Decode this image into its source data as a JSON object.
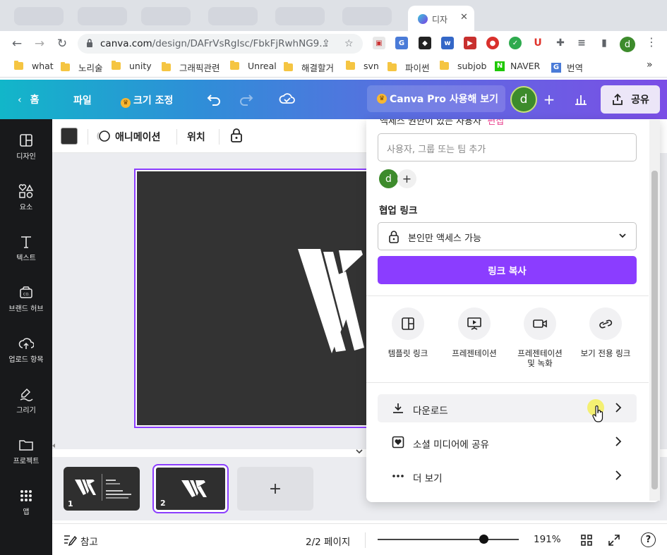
{
  "browser": {
    "active_tab_title": "디자",
    "url_host": "canva.com",
    "url_path": "/design/DAFrVsRgIsc/FbkFjRwhNG9...",
    "profile_initial": "d",
    "bookmarks": [
      "what",
      "노리술",
      "unity",
      "그래픽관련",
      "Unreal",
      "해결할거",
      "svn",
      "파이썬",
      "subjob",
      "NAVER",
      "번역"
    ],
    "more": "»"
  },
  "header": {
    "home": "홈",
    "file": "파일",
    "resize": "크기 조정",
    "pro_button": "Canva Pro 사용해 보기",
    "avatar_initial": "d",
    "plus": "+",
    "share": "공유"
  },
  "rail": {
    "items": [
      "디자인",
      "요소",
      "텍스트",
      "브랜드 허브",
      "업로드 항목",
      "그리기",
      "프로젝트",
      "앱"
    ]
  },
  "toolbar": {
    "animate": "애니메이션",
    "position": "위치"
  },
  "pages": {
    "thumb1": "1",
    "thumb2": "2",
    "add": "+"
  },
  "footer": {
    "notes": "참고",
    "page_indicator": "2/2 페이지",
    "zoom": "191%",
    "zoom_level": 0.73,
    "help": "?"
  },
  "share_panel": {
    "cut_header": "액세스 권한이 있는 사용자",
    "cut_edit": "편집",
    "people_placeholder": "사용자, 그룹 또는 팀 추가",
    "owner_initial": "d",
    "add": "+",
    "collab_label": "협업 링크",
    "access": "본인만 액세스 가능",
    "copy_link": "링크 복사",
    "options": [
      "템플릿 링크",
      "프레젠테이션",
      "프레젠테이션 및 녹화",
      "보기 전용 링크"
    ],
    "rows": [
      "다운로드",
      "소셜 미디어에 공유",
      "더 보기"
    ]
  },
  "colors": {
    "accent": "#8b3dff",
    "canvas_bg": "#333333",
    "header_start": "#12b6c9",
    "header_end": "#7b4ee6"
  }
}
